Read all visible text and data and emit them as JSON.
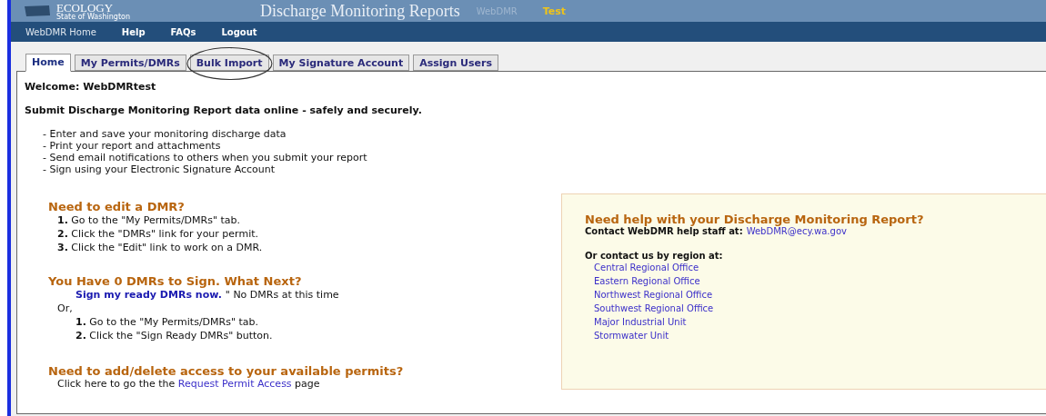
{
  "header": {
    "logo_title": "ECOLOGY",
    "logo_subtitle": "State of Washington",
    "title": "Discharge Monitoring Reports",
    "app": "WebDMR",
    "environment": "Test"
  },
  "nav": [
    {
      "label": "WebDMR Home",
      "selected": true
    },
    {
      "label": "Help",
      "selected": false
    },
    {
      "label": "FAQs",
      "selected": false
    },
    {
      "label": "Logout",
      "selected": false
    }
  ],
  "tabs": [
    {
      "label": "Home",
      "selected": true
    },
    {
      "label": "My Permits/DMRs",
      "selected": false
    },
    {
      "label": "Bulk Import",
      "selected": false,
      "circled": true
    },
    {
      "label": "My Signature Account",
      "selected": false
    },
    {
      "label": "Assign Users",
      "selected": false
    }
  ],
  "welcome": "Welcome: WebDMRtest",
  "tagline": "Submit Discharge Monitoring Report data online - safely and securely.",
  "features": [
    "- Enter and save your monitoring discharge data",
    "- Print your report and attachments",
    "- Send email notifications to others when you submit your report",
    "- Sign using your Electronic Signature Account"
  ],
  "edit_section": {
    "heading": "Need to edit a DMR?",
    "steps": [
      "**1.** Go to the \"My Permits/DMRs\" tab.",
      "**2.** Click the \"DMRs\" link for your permit.",
      "**3.** Click the \"Edit\" link to work on a DMR."
    ]
  },
  "sign_section": {
    "heading": "You Have 0 DMRs to Sign. What Next?",
    "link": "Sign my ready DMRs now.",
    "note": "\" No DMRs at this time",
    "or": "Or,",
    "steps": [
      "**1.** Go to the \"My Permits/DMRs\" tab.",
      "**2.** Click the \"Sign Ready DMRs\" button."
    ]
  },
  "access_section": {
    "heading": "Need to add/delete access to your available permits?",
    "before": "Click here to go the the ",
    "link": "Request Permit Access",
    "after": " page"
  },
  "help_box": {
    "heading": "Need help with your Discharge Monitoring Report?",
    "contact_label": "Contact WebDMR help staff at:",
    "email": "WebDMR@ecy.wa.gov",
    "region_label": "Or contact us by region at:",
    "offices": [
      "Central Regional Office",
      "Eastern Regional Office",
      "Northwest Regional Office",
      "Southwest Regional Office",
      "Major Industrial Unit",
      "Stormwater Unit"
    ]
  }
}
